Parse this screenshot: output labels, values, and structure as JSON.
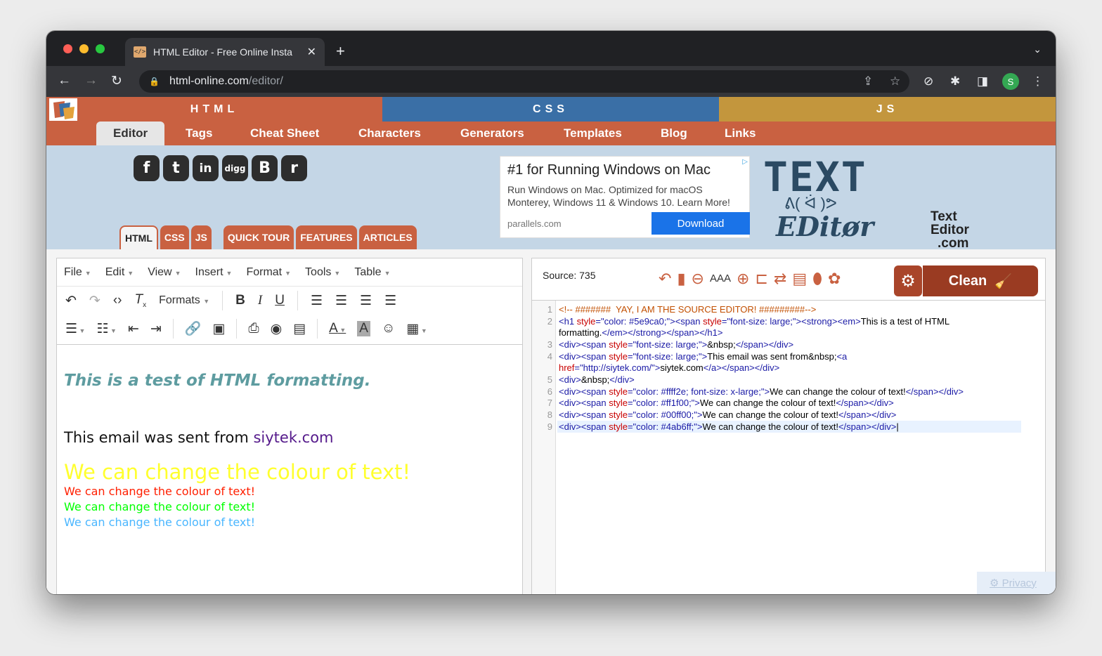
{
  "browser": {
    "tab_title": "HTML Editor - Free Online Insta",
    "tab_favicon": "</>",
    "url_host": "html-online.com",
    "url_path": "/editor/",
    "profile_initial": "S",
    "colors": {
      "close": "#ff5f57",
      "minimize": "#febc2e",
      "zoom": "#28c840"
    }
  },
  "site": {
    "lang_tabs": [
      {
        "label": "HTML",
        "color": "#c96141"
      },
      {
        "label": "CSS",
        "color": "#3a6fa6"
      },
      {
        "label": "JS",
        "color": "#c3963d"
      }
    ],
    "nav": [
      "Editor",
      "Tags",
      "Cheat Sheet",
      "Characters",
      "Generators",
      "Templates",
      "Blog",
      "Links"
    ],
    "social": [
      "f",
      "t",
      "in",
      "digg",
      "B",
      "r"
    ],
    "subtabs": [
      "HTML",
      "CSS",
      "JS",
      "QUICK TOUR",
      "FEATURES",
      "ARTICLES"
    ],
    "ad": {
      "title": "#1 for Running Windows on Mac",
      "body": "Run Windows on Mac. Optimized for macOS Monterey, Windows 11 & Windows 10. Learn More!",
      "domain": "parallels.com",
      "button": "Download"
    },
    "logo_small": {
      "line1": "Text",
      "line2": "Editor",
      "line3": ".com"
    },
    "privacy": "Privacy"
  },
  "wysiwyg": {
    "menu": [
      "File",
      "Edit",
      "View",
      "Insert",
      "Format",
      "Tools",
      "Table"
    ],
    "formats_label": "Formats",
    "heading": "This is a test of HTML formatting.",
    "email_prefix": "This email was sent from ",
    "email_link": "siytek.com",
    "colour_lines": [
      {
        "text": "We can change the colour of text!",
        "color": "#ffff2e"
      },
      {
        "text": "We can change the colour of text!",
        "color": "#ff1f00"
      },
      {
        "text": "We can change the colour of text!",
        "color": "#00ff00"
      },
      {
        "text": "We can change the colour of text!",
        "color": "#4ab6ff"
      }
    ]
  },
  "source": {
    "label": "Source: 735",
    "clean_label": "Clean",
    "line_numbers": [
      "1",
      "2",
      "",
      "3",
      "4",
      "",
      "5",
      "6",
      "7",
      "8",
      "9"
    ]
  }
}
